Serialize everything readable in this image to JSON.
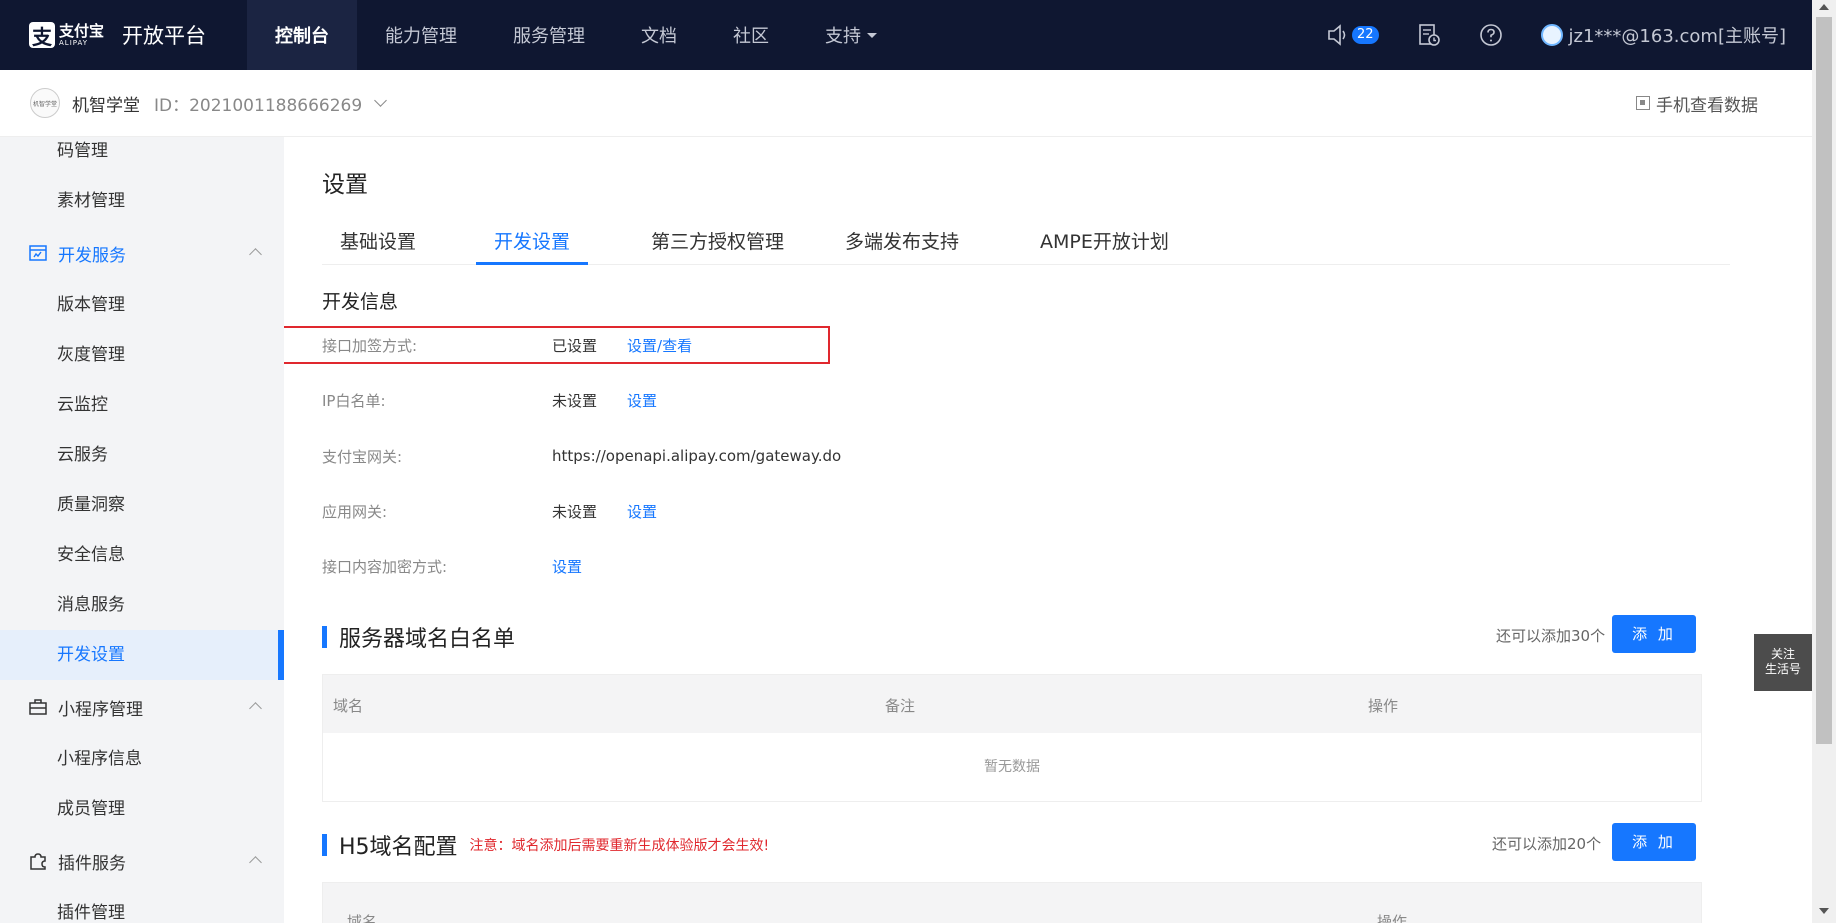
{
  "topnav": {
    "logo_cn": "支付宝",
    "logo_en": "ALIPAY",
    "logo_icon_char": "支",
    "platform": "开放平台",
    "items": [
      {
        "label": "控制台",
        "active": true
      },
      {
        "label": "能力管理"
      },
      {
        "label": "服务管理"
      },
      {
        "label": "文档"
      },
      {
        "label": "社区"
      },
      {
        "label": "支持"
      }
    ],
    "notification_count": "22",
    "account": "jz1***@163.com[主账号]"
  },
  "subheader": {
    "app_logo_text": "机智学堂",
    "app_name": "机智学堂",
    "app_id": "ID：2021001188666269",
    "mobile_data": "手机查看数据"
  },
  "sidebar": {
    "item_code": "码管理",
    "item_material": "素材管理",
    "group_dev": "开发服务",
    "dev_items": [
      "版本管理",
      "灰度管理",
      "云监控",
      "云服务",
      "质量洞察",
      "安全信息",
      "消息服务",
      "开发设置"
    ],
    "group_miniapp": "小程序管理",
    "miniapp_items": [
      "小程序信息",
      "成员管理"
    ],
    "group_plugin": "插件服务",
    "plugin_items": [
      "插件管理"
    ]
  },
  "main": {
    "title": "设置",
    "tabs": [
      "基础设置",
      "开发设置",
      "第三方授权管理",
      "多端发布支持",
      "AMPE开放计划"
    ],
    "dev_info_title": "开发信息",
    "rows": [
      {
        "label": "接口加签方式:",
        "value": "已设置",
        "action": "设置/查看"
      },
      {
        "label": "IP白名单:",
        "value": "未设置",
        "action": "设置"
      },
      {
        "label": "支付宝网关:",
        "value": "https://openapi.alipay.com/gateway.do"
      },
      {
        "label": "应用网关:",
        "value": "未设置",
        "action": "设置"
      },
      {
        "label": "接口内容加密方式:",
        "action": "设置"
      }
    ],
    "server_domain": {
      "title": "服务器域名白名单",
      "remain": "还可以添加30个",
      "add": "添 加",
      "headers": [
        "域名",
        "备注",
        "操作"
      ],
      "empty": "暂无数据"
    },
    "h5_domain": {
      "title": "H5域名配置",
      "note": "注意：域名添加后需要重新生成体验版才会生效!",
      "remain": "还可以添加20个",
      "add": "添 加",
      "headers": [
        "域名",
        "操作"
      ]
    }
  },
  "follow": {
    "line1": "关注",
    "line2": "生活号"
  }
}
